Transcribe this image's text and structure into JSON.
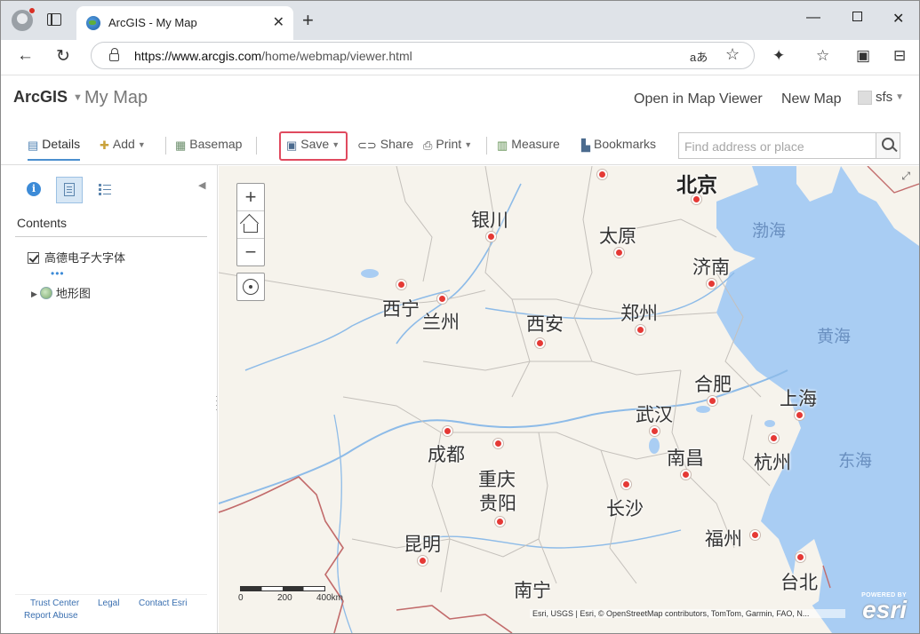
{
  "browser": {
    "tab_title": "ArcGIS - My Map",
    "url_host": "https://www.arcgis.com",
    "url_path": "/home/webmap/viewer.html",
    "read_aloud": "aあ"
  },
  "app": {
    "brand": "ArcGIS",
    "map_title": "My Map",
    "open_in_viewer": "Open in Map Viewer",
    "new_map": "New Map",
    "user": "sfs"
  },
  "toolbar": {
    "details": "Details",
    "add": "Add",
    "basemap": "Basemap",
    "save": "Save",
    "share": "Share",
    "print": "Print",
    "measure": "Measure",
    "bookmarks": "Bookmarks",
    "search_placeholder": "Find address or place"
  },
  "panel": {
    "title": "Contents",
    "layers": [
      {
        "name": "高德电子大字体",
        "checked": true
      },
      {
        "name": "地形图"
      }
    ],
    "footer": {
      "trust_center": "Trust Center",
      "legal": "Legal",
      "contact": "Contact Esri",
      "report": "Report Abuse"
    }
  },
  "map": {
    "cities": [
      {
        "name": "北京"
      },
      {
        "name": "银川"
      },
      {
        "name": "太原"
      },
      {
        "name": "济南"
      },
      {
        "name": "西宁"
      },
      {
        "name": "兰州"
      },
      {
        "name": "西安"
      },
      {
        "name": "郑州"
      },
      {
        "name": "合肥"
      },
      {
        "name": "上海"
      },
      {
        "name": "武汉"
      },
      {
        "name": "成都"
      },
      {
        "name": "南昌"
      },
      {
        "name": "杭州"
      },
      {
        "name": "重庆"
      },
      {
        "name": "贵阳"
      },
      {
        "name": "长沙"
      },
      {
        "name": "昆明"
      },
      {
        "name": "福州"
      },
      {
        "name": "台北"
      },
      {
        "name": "南宁"
      }
    ],
    "seas": [
      "渤海",
      "黄海",
      "东海"
    ],
    "scale_labels": [
      "0",
      "200",
      "400km"
    ],
    "attribution": "Esri, USGS | Esri, © OpenStreetMap contributors, TomTom, Garmin, FAO, N...",
    "powered_by": "POWERED BY",
    "esri_logo": "esri"
  },
  "colors": {
    "save_highlight": "#e04a5f",
    "sea": "#a9cdf3",
    "land": "#f6f3ec",
    "city_dot": "#e53935"
  }
}
